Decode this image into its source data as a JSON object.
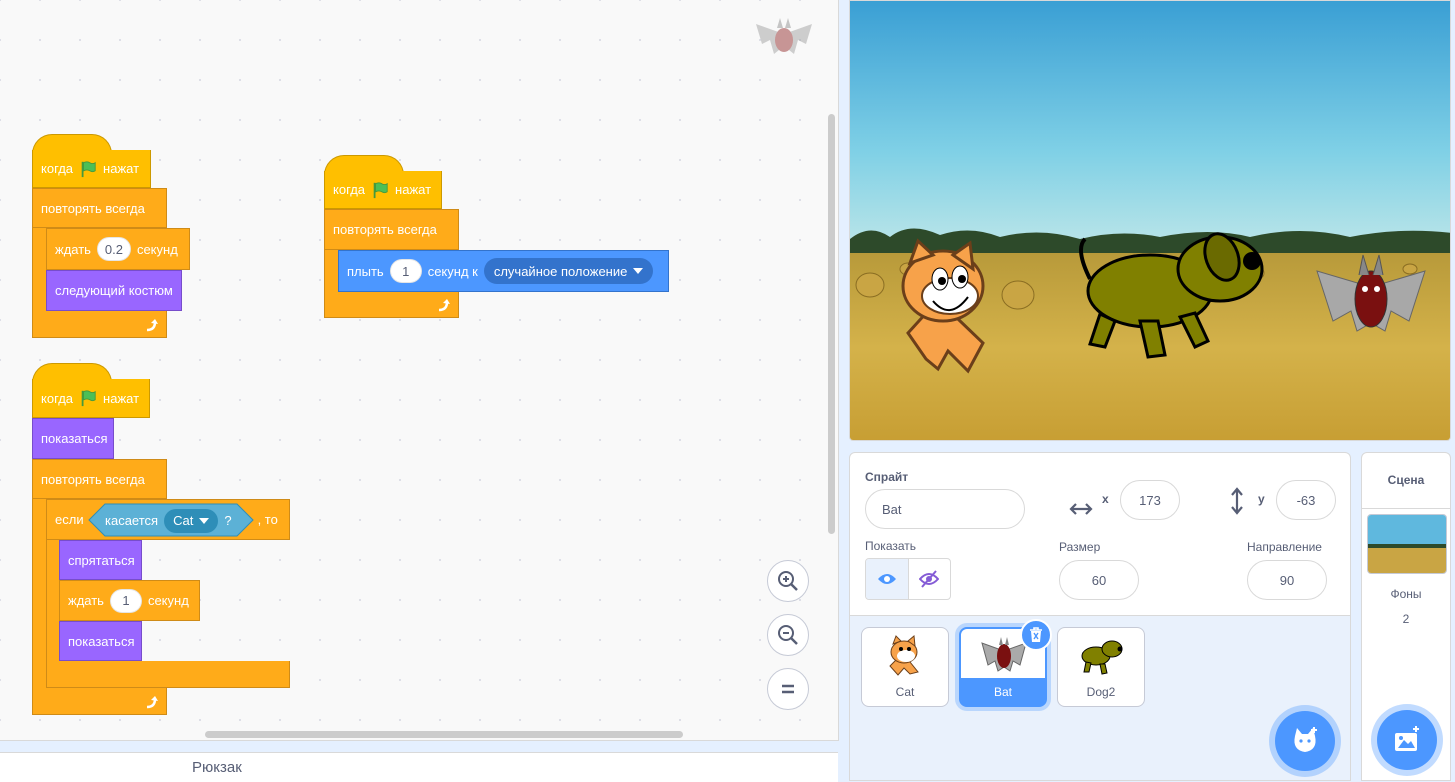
{
  "scripts": {
    "s1": {
      "hat": {
        "when": "когда",
        "clicked": "нажат"
      },
      "forever": "повторять всегда",
      "wait": {
        "label": "ждать",
        "value": "0.2",
        "unit": "секунд"
      },
      "next_costume": "следующий костюм"
    },
    "s2": {
      "hat": {
        "when": "когда",
        "clicked": "нажат"
      },
      "forever": "повторять всегда",
      "glide": {
        "label": "плыть",
        "value": "1",
        "mid": "секунд к",
        "target": "случайное положение"
      }
    },
    "s3": {
      "hat": {
        "when": "когда",
        "clicked": "нажат"
      },
      "show": "показаться",
      "forever": "повторять всегда",
      "if": {
        "label": "если",
        "touching": "касается",
        "target": "Cat",
        "q": "?",
        "then": ", то"
      },
      "hide": "спрятаться",
      "wait": {
        "label": "ждать",
        "value": "1",
        "unit": "секунд"
      },
      "show2": "показаться"
    }
  },
  "backpack": "Рюкзак",
  "sprite_info": {
    "sprite_label": "Спрайт",
    "sprite_name": "Bat",
    "x_label": "x",
    "x_value": "173",
    "y_label": "y",
    "y_value": "-63",
    "show_label": "Показать",
    "size_label": "Размер",
    "size_value": "60",
    "direction_label": "Направление",
    "direction_value": "90"
  },
  "sprites": [
    {
      "name": "Cat",
      "selected": false
    },
    {
      "name": "Bat",
      "selected": true
    },
    {
      "name": "Dog2",
      "selected": false
    }
  ],
  "stage_panel": {
    "title": "Сцена",
    "backdrops_label": "Фоны",
    "backdrops_count": "2"
  },
  "colors": {
    "accent": "#4c97ff",
    "events": "#ffbf00",
    "control": "#ffab19",
    "looks": "#9966ff",
    "motion": "#4c97ff",
    "sensing": "#5cb1d6"
  }
}
